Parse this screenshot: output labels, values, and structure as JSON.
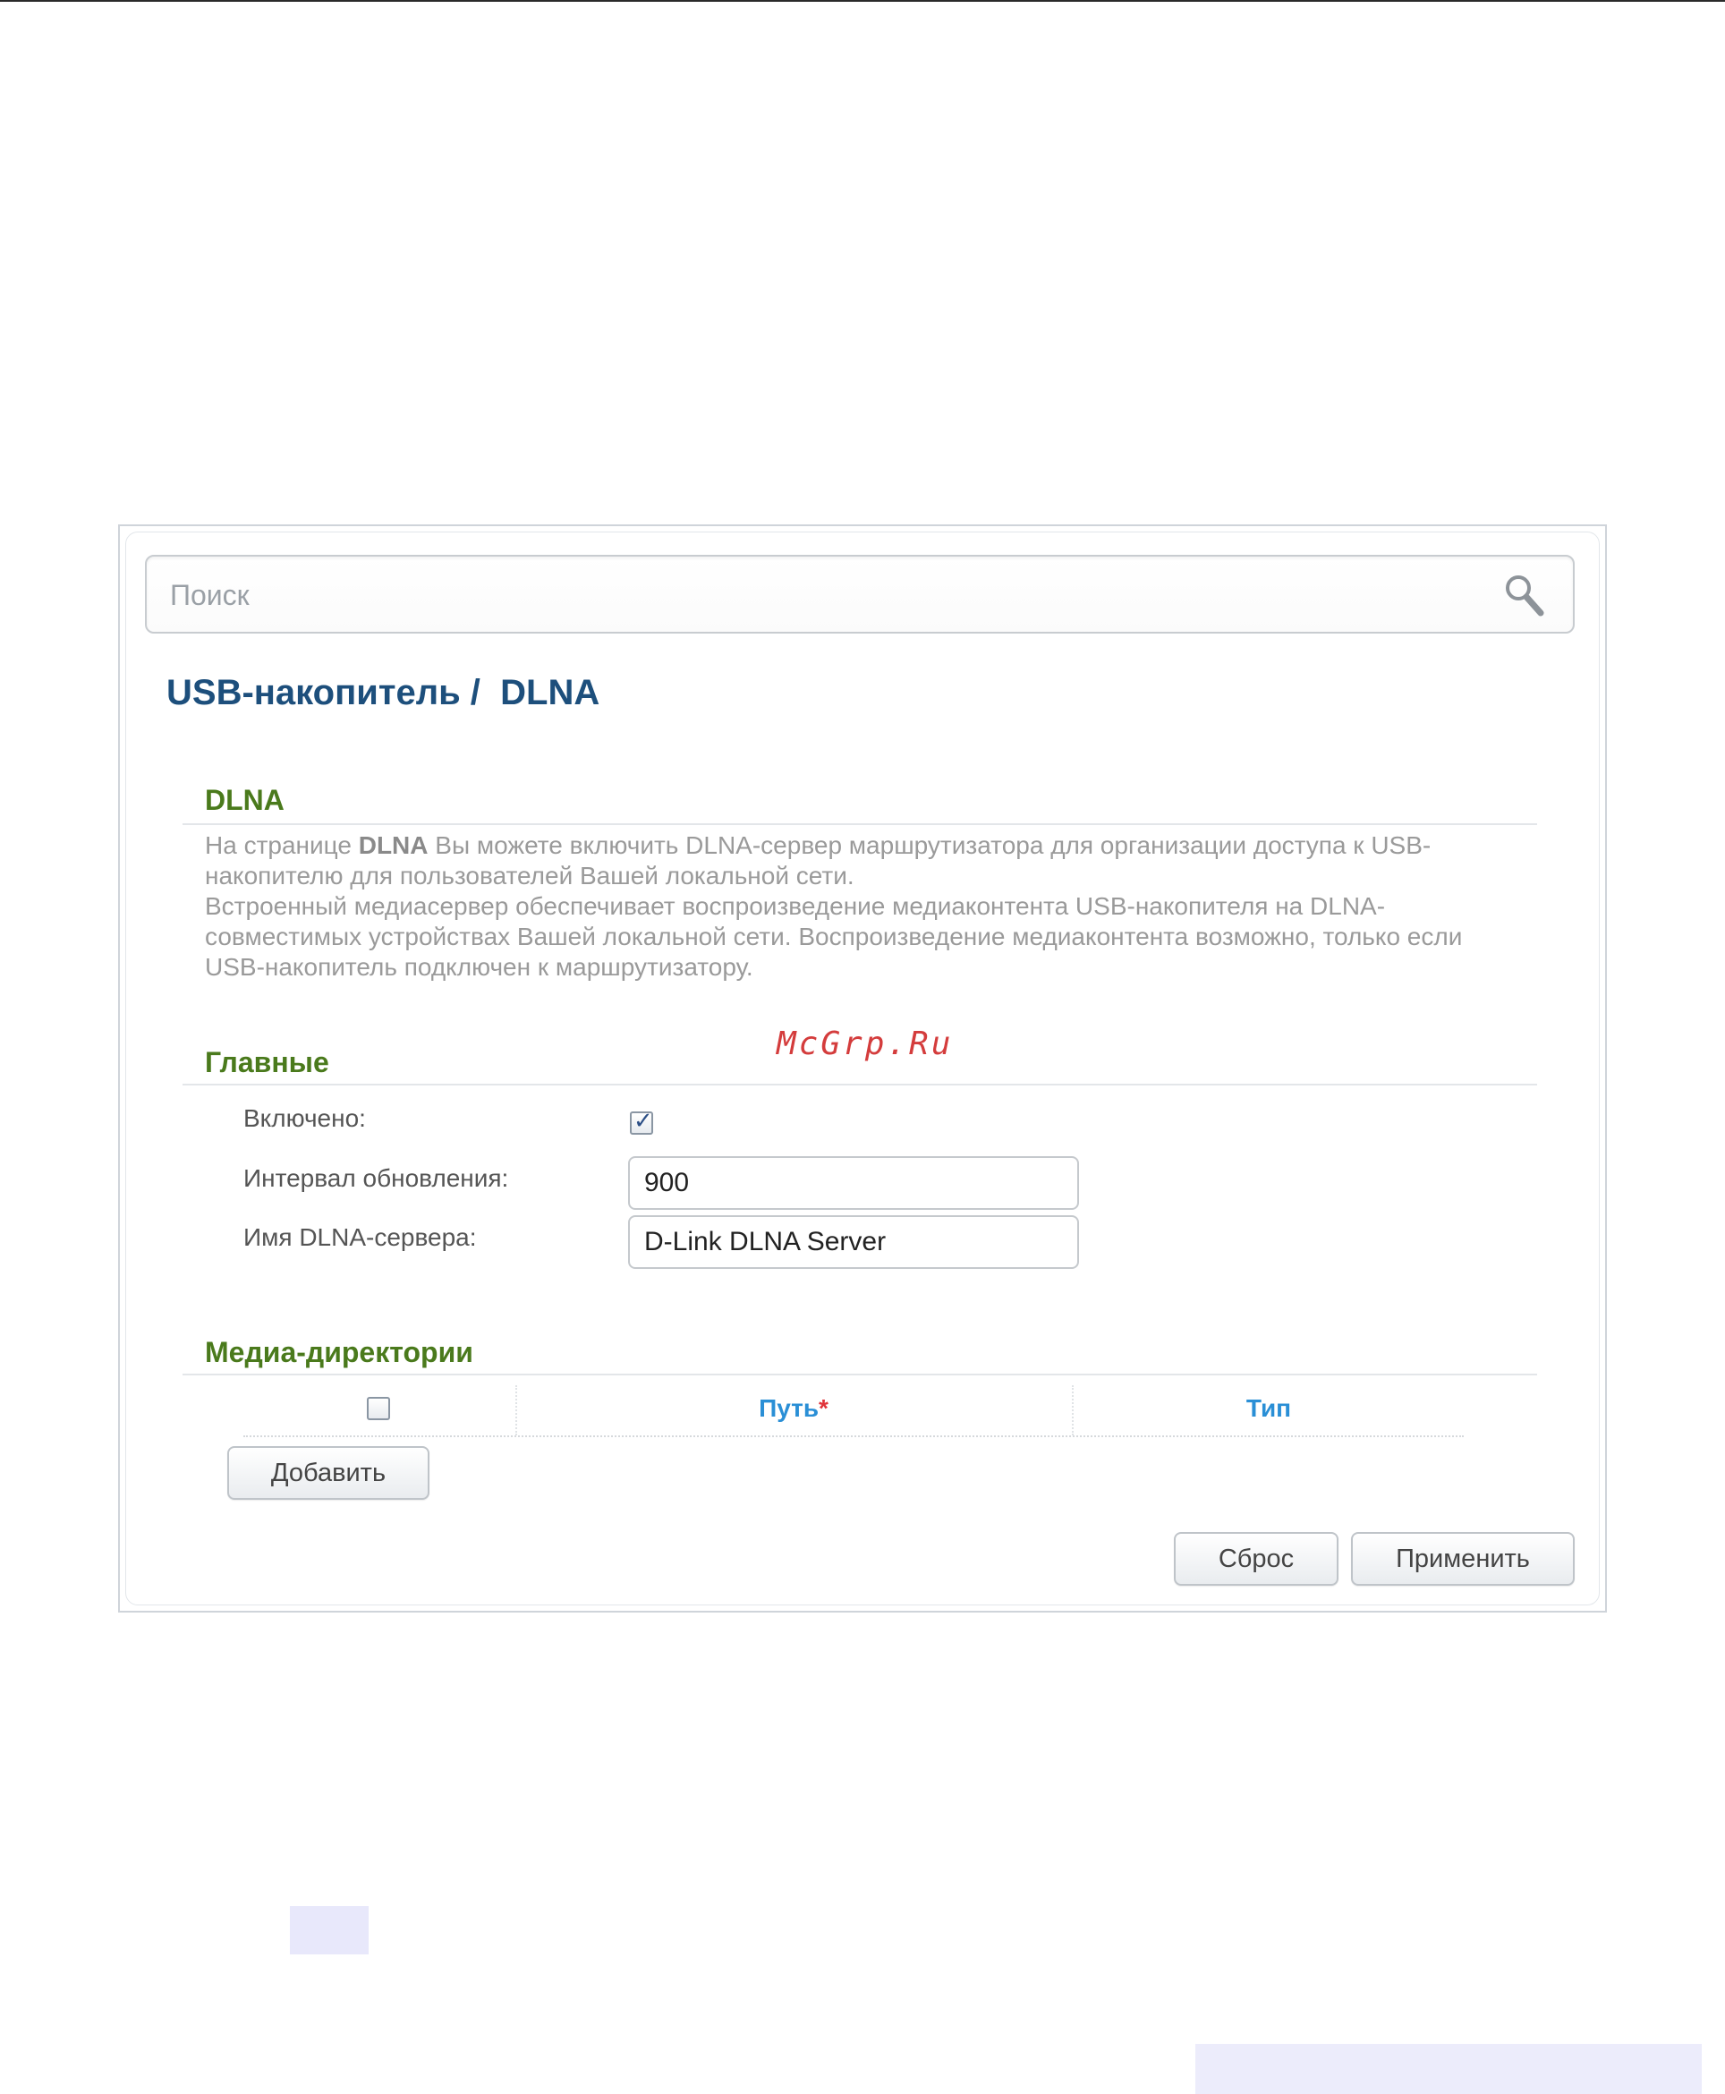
{
  "search": {
    "placeholder": "Поиск"
  },
  "header": {
    "breadcrumb": "USB-накопитель /  DLNA"
  },
  "intro": {
    "title": "DLNA",
    "text_prefix": "На странице ",
    "text_bold": "DLNA",
    "text_rest": " Вы можете включить DLNA-сервер маршрутизатора для организации доступа к USB-накопителю для пользователей Вашей локальной сети.",
    "text_para2": "Встроенный медиасервер обеспечивает воспроизведение медиаконтента USB-накопителя на DLNA-совместимых устройствах Вашей локальной сети. Воспроизведение медиаконтента возможно, только если USB-накопитель подключен к маршрутизатору."
  },
  "watermark": "McGrp.Ru",
  "general": {
    "title": "Главные",
    "enabled_label": "Включено:",
    "enabled": true,
    "interval_label": "Интервал обновления:",
    "interval_value": "900",
    "server_name_label": "Имя DLNA-сервера:",
    "server_name_value": "D-Link DLNA Server"
  },
  "media": {
    "title": "Медиа-директории",
    "columns": [
      {
        "label": "Путь",
        "required_mark": "*"
      },
      {
        "label": "Тип"
      }
    ],
    "add_button": "Добавить"
  },
  "actions": {
    "reset": "Сброс",
    "apply": "Применить"
  },
  "colors": {
    "title_blue": "#1d4f7c",
    "section_green": "#4a7a1c",
    "column_blue": "#2a8fd6",
    "required_red": "#e0343a",
    "watermark_red": "#d43c3c"
  }
}
